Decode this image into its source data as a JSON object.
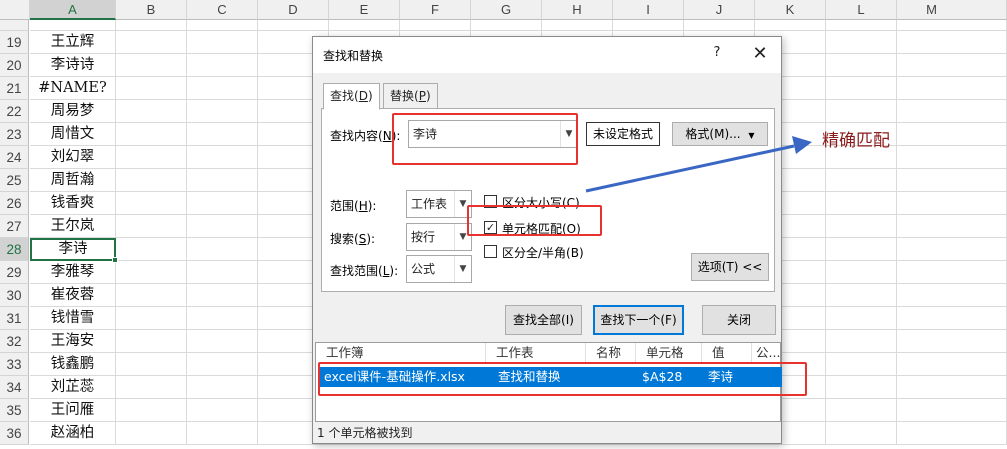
{
  "columns": [
    "A",
    "B",
    "C",
    "D",
    "E",
    "F",
    "G",
    "H",
    "I",
    "J",
    "K",
    "L",
    "M"
  ],
  "rows": [
    {
      "num": "19",
      "a": "王立辉"
    },
    {
      "num": "20",
      "a": "李诗诗"
    },
    {
      "num": "21",
      "a": "#NAME?"
    },
    {
      "num": "22",
      "a": "周易梦"
    },
    {
      "num": "23",
      "a": "周惜文"
    },
    {
      "num": "24",
      "a": "刘幻翠"
    },
    {
      "num": "25",
      "a": "周哲瀚"
    },
    {
      "num": "26",
      "a": "钱香爽"
    },
    {
      "num": "27",
      "a": "王尔岚"
    },
    {
      "num": "28",
      "a": "李诗"
    },
    {
      "num": "29",
      "a": "李雅琴"
    },
    {
      "num": "30",
      "a": "崔夜蓉"
    },
    {
      "num": "31",
      "a": "钱惜雪"
    },
    {
      "num": "32",
      "a": "王海安"
    },
    {
      "num": "33",
      "a": "钱鑫鹏"
    },
    {
      "num": "34",
      "a": "刘芷蕊"
    },
    {
      "num": "35",
      "a": "王问雁"
    },
    {
      "num": "36",
      "a": "赵涵柏"
    }
  ],
  "dialog": {
    "title": "查找和替换",
    "help": "?",
    "close": "✕",
    "tabs": [
      {
        "label": "查找",
        "key": "D"
      },
      {
        "label": "替换",
        "key": "P"
      }
    ],
    "find_label": "查找内容",
    "find_key": "N",
    "find_value": "李诗",
    "no_format": "未设定格式",
    "format_btn": "格式(M)...",
    "scope_label": "范围",
    "scope_key": "H",
    "scope_value": "工作表",
    "search_label": "搜索",
    "search_key": "S",
    "search_value": "按行",
    "lookin_label": "查找范围",
    "lookin_key": "L",
    "lookin_value": "公式",
    "match_case": "区分大小写(C)",
    "match_cell": "单元格匹配(O)",
    "match_byte": "区分全/半角(B)",
    "options_btn": "选项(T) <<",
    "find_all": "查找全部(I)",
    "find_next": "查找下一个(F)",
    "close_btn": "关闭",
    "result_headers": [
      "工作簿",
      "工作表",
      "名称",
      "单元格",
      "值",
      "公..."
    ],
    "result": {
      "book": "excel课件-基础操作.xlsx",
      "sheet": "查找和替换",
      "name": "",
      "cell": "$A$28",
      "value": "李诗"
    },
    "status": "1 个单元格被找到"
  },
  "annotation": "精确匹配",
  "colors": {
    "accent": "#217346",
    "selection": "#0078d7",
    "highlight": "#e8322f",
    "arrow": "#3a66c4",
    "annotation": "#8b1a1a"
  }
}
